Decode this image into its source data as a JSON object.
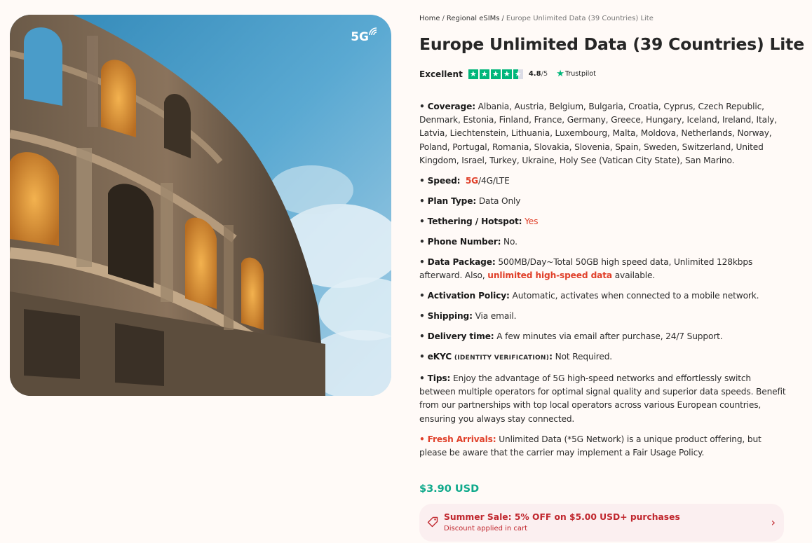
{
  "hero": {
    "badge_label": "5G"
  },
  "breadcrumb": {
    "items": [
      "Home",
      "Regional eSIMs"
    ],
    "separator": "/",
    "current": "Europe Unlimited Data (39 Countries) Lite"
  },
  "product": {
    "title": "Europe Unlimited Data (39 Countries) Lite"
  },
  "rating": {
    "label": "Excellent",
    "score": "4.8",
    "out_of": "/5",
    "stars": 4.5,
    "provider": "Trustpilot",
    "star_color": "#00b67a"
  },
  "specs": {
    "coverage": {
      "label": "Coverage:",
      "value": "Albania, Austria, Belgium, Bulgaria, Croatia, Cyprus, Czech Republic, Denmark, Estonia, Finland, France, Germany, Greece, Hungary, Iceland, Ireland, Italy, Latvia, Liechtenstein, Lithuania, Luxembourg, Malta, Moldova, Netherlands, Norway, Poland, Portugal, Romania, Slovakia, Slovenia, Spain, Sweden, Switzerland, United Kingdom, Israel, Turkey, Ukraine, Holy See (Vatican City State), San Marino."
    },
    "speed": {
      "label": "Speed:",
      "highlight": "5G",
      "rest": "/4G/LTE"
    },
    "plan_type": {
      "label": "Plan Type:",
      "value": "Data Only"
    },
    "tethering": {
      "label": "Tethering / Hotspot:",
      "value": "Yes"
    },
    "phone_number": {
      "label": "Phone Number:",
      "value": "No."
    },
    "data_package": {
      "label": "Data Package:",
      "value": "500MB/Day~Total 50GB high speed data, Unlimited 128kbps afterward. Also,",
      "link": "unlimited high-speed data",
      "tail": "available."
    },
    "activation": {
      "label": "Activation Policy:",
      "value": "Automatic, activates when connected to a mobile network."
    },
    "shipping": {
      "label": "Shipping:",
      "value": "Via email."
    },
    "delivery": {
      "label": "Delivery time:",
      "value": "A few minutes via email after purchase, 24/7 Support."
    },
    "ekyc": {
      "label": "eKYC",
      "note": "(IDENTITY VERIFICATION)",
      "colon": ":",
      "value": "Not Required."
    },
    "tips": {
      "label": "Tips:",
      "value": "Enjoy the advantage of 5G high-speed networks and effortlessly switch between multiple operators for optimal signal quality and superior data speeds. Benefit from our partnerships with top local operators across various European countries, ensuring you always stay connected."
    },
    "fresh": {
      "label": "Fresh Arrivals:",
      "value": "Unlimited Data (*5G Network) is a unique product offering, but please be aware that the carrier may implement a Fair Usage Policy."
    }
  },
  "price": "$3.90 USD",
  "promo": {
    "title": "Summer Sale: 5% OFF on $5.00 USD+ purchases",
    "subtitle": "Discount applied in cart",
    "icon": "tag-icon",
    "color": "#c0262d"
  },
  "colors": {
    "accent_red": "#e0402a",
    "price_green": "#0fa98b",
    "background": "#fffaf7"
  }
}
